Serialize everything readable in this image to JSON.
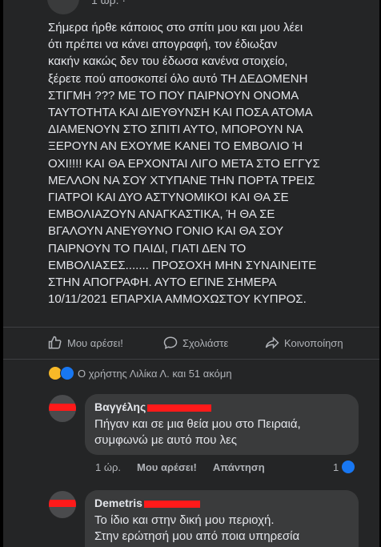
{
  "post": {
    "time": "1 ώρ. · ",
    "lines": [
      "Σήμερα ήρθε κάποιος στο σπίτι μου και μου λέει",
      "ότι πρέπει να κάνει απογραφή, τον έδιωξαν",
      "κακήν κακώς δεν του έδωσα κανένα στοιχείο,",
      "ξέρετε πού αποσκοπεί όλο αυτό ΤΗ ΔΕΔΟΜΕΝΗ",
      "ΣΤΙΓΜΗ ??? ΜΕ ΤΟ ΠΟΥ ΠΑΙΡΝΟΥΝ ΟΝΟΜΑ",
      "ΤΑΥΤΟΤΗΤΑ ΚΑΙ ΔΙΕΥΘΥΝΣΗ ΚΑΙ ΠΟΣΑ ΑΤΟΜΑ",
      "ΔΙΑΜΕΝΟΥΝ ΣΤΟ ΣΠΙΤΙ ΑΥΤΟ, ΜΠΟΡΟΥΝ ΝΑ",
      "ΞΕΡΟΥΝ ΑΝ ΕΧΟΥΜΕ ΚΑΝΕΙ ΤΟ ΕΜΒΟΛΙΟ Ή",
      "ΟΧΙ!!!! ΚΑΙ ΘΑ ΕΡΧΟΝΤΑΙ ΛΙΓΟ ΜΕΤΑ ΣΤΟ ΕΓΓΥΣ",
      "ΜΕΛΛΟΝ ΝΑ ΣΟΥ ΧΤΥΠΑΝΕ ΤΗΝ ΠΟΡΤΑ ΤΡΕΙΣ",
      "ΓΙΑΤΡΟΙ ΚΑΙ ΔΥΟ ΑΣΤΥΝΟΜΙΚΟΙ ΚΑΙ ΘΑ ΣΕ",
      "ΕΜΒΟΛΙΑΖΟΥΝ ΑΝΑΓΚΑΣΤΙΚΑ, Ή ΘΑ ΣΕ",
      "ΒΓΑΛΟΥΝ ΑΝΕΥΘΥΝΟ ΓΟΝΙΟ ΚΑΙ ΘΑ ΣΟΥ",
      "ΠΑΙΡΝΟΥΝ ΤΟ ΠΑΙΔΙ, ΓΙΑΤΙ ΔΕΝ ΤΟ",
      "ΕΜΒΟΛΙΑΣΕΣ....... ΠΡΟΣΟΧΗ ΜΗΝ ΣΥΝΑΙΝΕΙΤΕ",
      "ΣΤΗΝ ΑΠΟΓΡΑΦΗ. ΑΥΤΟ ΕΓΙΝΕ ΣΗΜΕΡΑ",
      "10/11/2021 ΕΠΑΡΧΙΑ ΑΜΜΟΧΩΣΤΟΥ ΚΥΠΡΟΣ."
    ]
  },
  "actions": {
    "like": "Μου αρέσει!",
    "comment": "Σχολιάστε",
    "share": "Κοινοποίηση"
  },
  "reactions": {
    "text": "Ο χρήστης Λιλίκα Λ. και 51 ακόμη"
  },
  "comments": [
    {
      "author": "Βαγγέλης",
      "text_lines": [
        "Πήγαν και σε μια θεία μου στο Πειραιά,",
        "συμφωνώ με αυτό που λες"
      ],
      "time": "1 ώρ.",
      "like": "Μου αρέσει!",
      "reply": "Απάντηση",
      "like_count": "1"
    },
    {
      "author": "Demetris",
      "text_lines": [
        "Το ίδιο και στην δική μου περιοχή.",
        "Στην ερώτησή μου από ποια υπηρεσία"
      ]
    }
  ],
  "colors": {
    "background": "#242526",
    "bubble": "#3a3b3c",
    "text": "#e4e6eb",
    "muted": "#b0b3b8",
    "redaction": "#ff1a1a",
    "brand": "#1877f2"
  }
}
